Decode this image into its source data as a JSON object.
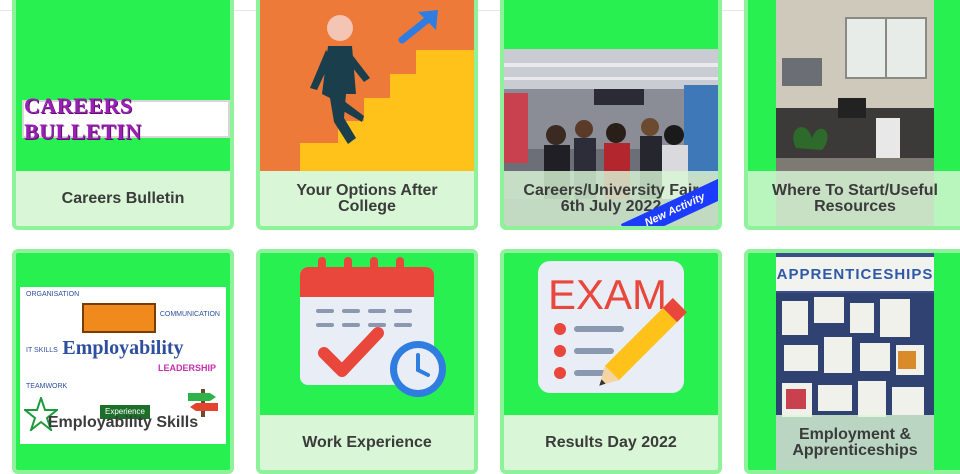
{
  "tiles": [
    {
      "id": "careers-bulletin",
      "label": "Careers Bulletin",
      "banner": "CAREERS BULLETIN"
    },
    {
      "id": "your-options",
      "label": "Your Options After College"
    },
    {
      "id": "careers-fair",
      "label": "Careers/University Fair 6th July 2022",
      "badge": "New Activity"
    },
    {
      "id": "where-to-start",
      "label": "Where To Start/Useful Resources"
    },
    {
      "id": "employability",
      "label": "Employability Skills",
      "poster_title": "Employability",
      "poster_words": [
        "ORGANISATION",
        "COMMUNICATION",
        "TEAMWORK",
        "LEADERSHIP",
        "IT SKILLS"
      ],
      "poster_footer": "Experience"
    },
    {
      "id": "work-experience",
      "label": "Work Experience"
    },
    {
      "id": "results-day",
      "label": "Results Day 2022",
      "exam_word": "EXAM"
    },
    {
      "id": "apprenticeships",
      "label": "Employment & Apprenticeships",
      "board_title": "APPRENTICESHIPS"
    }
  ],
  "colors": {
    "tile_green": "#28f050",
    "tile_border": "#8df29a",
    "label_bg": "#d9f7d6",
    "label_text": "#3b3b3b",
    "badge_blue": "#1b3cff"
  }
}
